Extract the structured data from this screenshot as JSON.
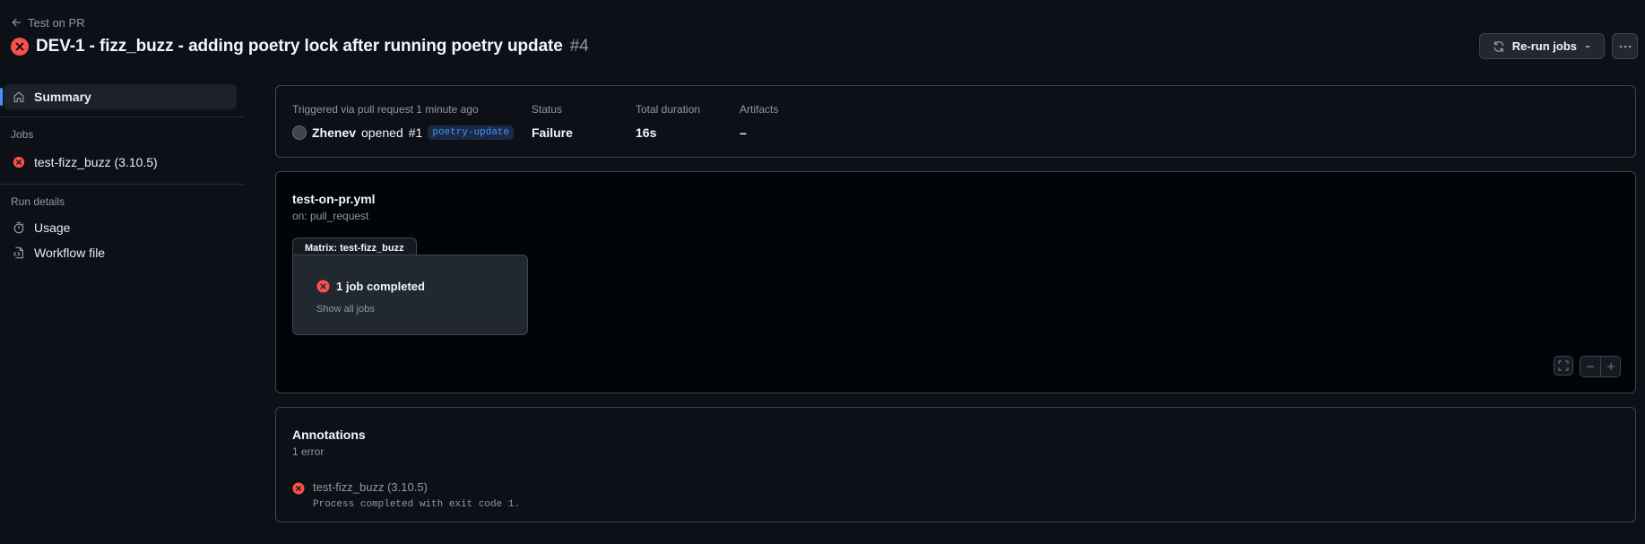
{
  "header": {
    "back_label": "Test on PR",
    "title": "DEV-1 - fizz_buzz - adding poetry lock after running poetry update",
    "run_number": "#4",
    "rerun_label": "Re-run jobs"
  },
  "sidebar": {
    "summary_label": "Summary",
    "jobs_heading": "Jobs",
    "jobs": [
      {
        "label": "test-fizz_buzz (3.10.5)",
        "status": "failure"
      }
    ],
    "run_details_heading": "Run details",
    "usage_label": "Usage",
    "workflow_file_label": "Workflow file"
  },
  "summary": {
    "trigger_label": "Triggered via pull request 1 minute ago",
    "actor": "Zhenev",
    "trigger_action": "opened",
    "pr_number": "#1",
    "branch": "poetry-update",
    "status_label": "Status",
    "status_value": "Failure",
    "duration_label": "Total duration",
    "duration_value": "16s",
    "artifacts_label": "Artifacts",
    "artifacts_value": "–"
  },
  "graph": {
    "workflow_file": "test-on-pr.yml",
    "trigger": "on: pull_request",
    "matrix_label": "Matrix: test-fizz_buzz",
    "job_summary": "1 job completed",
    "show_all": "Show all jobs"
  },
  "annotations": {
    "title": "Annotations",
    "count": "1 error",
    "items": [
      {
        "job": "test-fizz_buzz (3.10.5)",
        "message": "Process completed with exit code 1."
      }
    ]
  },
  "colors": {
    "background": "#0d1117",
    "border": "#3d444d",
    "error": "#f85149",
    "accent": "#4493f8",
    "muted_text": "#9198a1"
  }
}
